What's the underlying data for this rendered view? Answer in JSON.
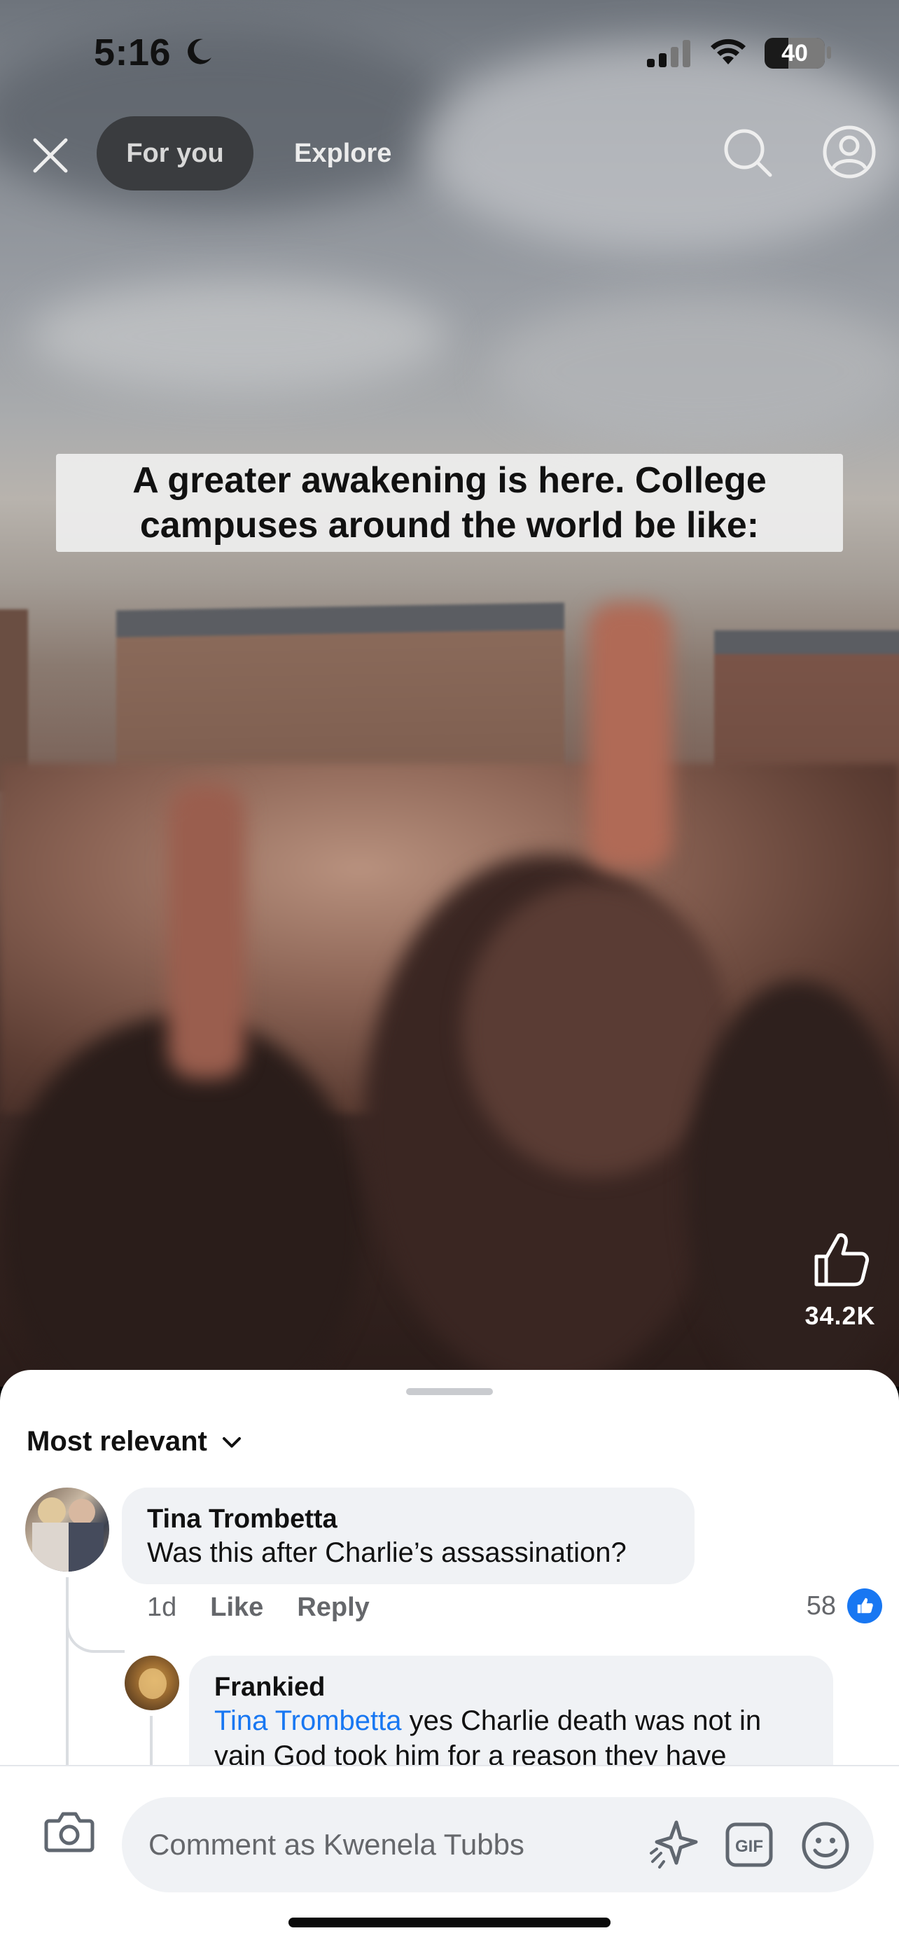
{
  "status_bar": {
    "time": "5:16",
    "battery": "40"
  },
  "nav": {
    "tabs": [
      {
        "label": "For you",
        "active": true
      },
      {
        "label": "Explore",
        "active": false
      }
    ]
  },
  "video": {
    "caption_line1": "A greater awakening is here. College",
    "caption_line2": "campuses around the world be like:",
    "like_count": "34.2K"
  },
  "comments": {
    "sort_label": "Most relevant",
    "items": [
      {
        "author": "Tina Trombetta",
        "text": "Was this after Charlie’s assassination?",
        "time": "1d",
        "like_label": "Like",
        "reply_label": "Reply",
        "reaction_count": "58"
      },
      {
        "author": "Frankied",
        "mention": "Tina Trombetta",
        "text_line1": " yes Charlie death was not in",
        "text_line2": "vain God took him for a reason they have"
      }
    ]
  },
  "composer": {
    "placeholder": "Comment as Kwenela Tubbs"
  },
  "colors": {
    "accent": "#1877f2",
    "bubble": "#f0f2f5",
    "secondary_text": "#65676b"
  }
}
